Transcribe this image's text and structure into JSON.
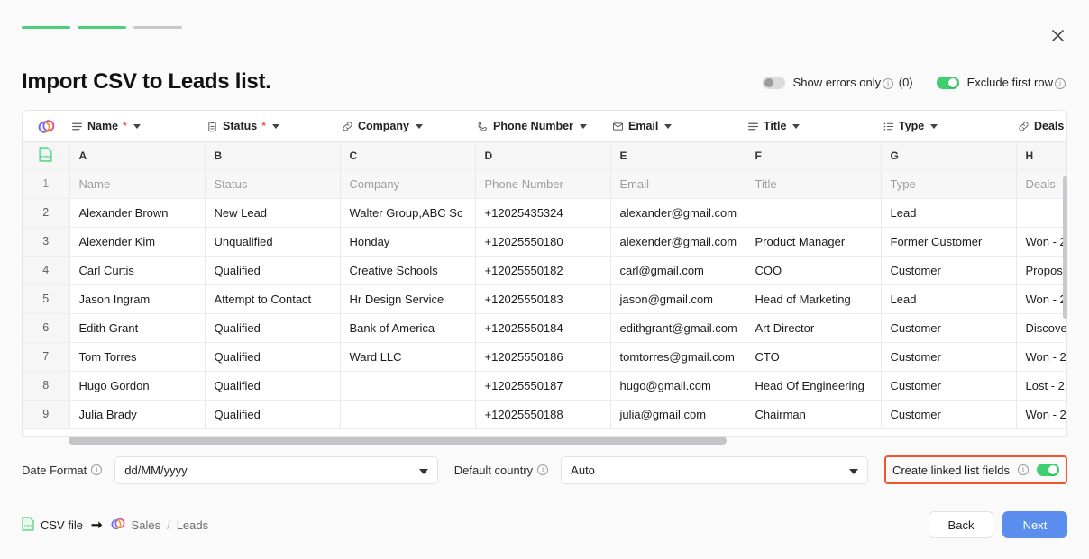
{
  "window": {
    "title": "Import CSV to Leads list.",
    "close_icon": "close-icon",
    "progress_steps": [
      "done",
      "done",
      "todo"
    ]
  },
  "top_controls": {
    "show_errors": {
      "label": "Show errors only",
      "count": "(0)",
      "state": "off",
      "info_icon": "info-icon"
    },
    "exclude_first_row": {
      "label": "Exclude first row",
      "state": "on",
      "info_icon": "info-icon"
    }
  },
  "mapping": {
    "logo_icon": "twenty-logo-icon",
    "fields": [
      {
        "label": "Name",
        "icon": "text-lines-icon",
        "required": "*"
      },
      {
        "label": "Status",
        "icon": "clipboard-icon",
        "required": "*"
      },
      {
        "label": "Company",
        "icon": "link-icon",
        "required": ""
      },
      {
        "label": "Phone Number",
        "icon": "phone-icon",
        "required": ""
      },
      {
        "label": "Email",
        "icon": "envelope-icon",
        "required": ""
      },
      {
        "label": "Title",
        "icon": "text-lines-icon",
        "required": ""
      },
      {
        "label": "Type",
        "icon": "list-icon",
        "required": ""
      },
      {
        "label": "Deals",
        "icon": "link-icon",
        "required": ""
      }
    ]
  },
  "sheet": {
    "corner_icon": "csv-file-icon",
    "column_letters": [
      "A",
      "B",
      "C",
      "D",
      "E",
      "F",
      "G",
      "H"
    ],
    "rows": [
      {
        "num": "1",
        "excluded": true,
        "cells": [
          "Name",
          "Status",
          "Company",
          "Phone Number",
          "Email",
          "Title",
          "Type",
          "Deals"
        ]
      },
      {
        "num": "2",
        "excluded": false,
        "cells": [
          "Alexander Brown",
          "New Lead",
          "Walter Group,ABC Sc",
          "+12025435324",
          "alexander@gmail.com",
          "",
          "Lead",
          ""
        ]
      },
      {
        "num": "3",
        "excluded": false,
        "cells": [
          "Alexender Kim",
          "Unqualified",
          "Honday",
          "+12025550180",
          "alexender@gmail.com",
          "Product Manager",
          "Former Customer",
          "Won - 2"
        ]
      },
      {
        "num": "4",
        "excluded": false,
        "cells": [
          "Carl Curtis",
          "Qualified",
          "Creative Schools",
          "+12025550182",
          "carl@gmail.com",
          "COO",
          "Customer",
          "Proposal"
        ]
      },
      {
        "num": "5",
        "excluded": false,
        "cells": [
          "Jason Ingram",
          "Attempt to Contact",
          "Hr Design Service",
          "+12025550183",
          "jason@gmail.com",
          "Head of Marketing",
          "Lead",
          "Won - 2"
        ]
      },
      {
        "num": "6",
        "excluded": false,
        "cells": [
          "Edith Grant",
          "Qualified",
          "Bank of America",
          "+12025550184",
          "edithgrant@gmail.com",
          "Art Director",
          "Customer",
          "Discovery"
        ]
      },
      {
        "num": "7",
        "excluded": false,
        "cells": [
          "Tom Torres",
          "Qualified",
          "Ward LLC",
          "+12025550186",
          "tomtorres@gmail.com",
          "CTO",
          "Customer",
          "Won - 2"
        ]
      },
      {
        "num": "8",
        "excluded": false,
        "cells": [
          "Hugo Gordon",
          "Qualified",
          "",
          "+12025550187",
          "hugo@gmail.com",
          "Head Of Engineering",
          "Customer",
          "Lost - 2"
        ]
      },
      {
        "num": "9",
        "excluded": false,
        "cells": [
          "Julia Brady",
          "Qualified",
          "",
          "+12025550188",
          "julia@gmail.com",
          "Chairman",
          "Customer",
          "Won - 2"
        ]
      }
    ]
  },
  "options": {
    "date_format": {
      "label": "Date Format",
      "value": "dd/MM/yyyy",
      "info_icon": "info-icon"
    },
    "default_country": {
      "label": "Default country",
      "value": "Auto",
      "info_icon": "info-icon"
    },
    "create_linked_list_fields": {
      "label": "Create linked list fields",
      "state": "on",
      "info_icon": "info-icon",
      "highlight_color": "#f4542e"
    }
  },
  "footer": {
    "source_label": "CSV file",
    "source_icon": "csv-file-icon",
    "arrow_icon": "arrow-right-icon",
    "dest_logo_icon": "twenty-logo-icon",
    "dest_workspace": "Sales",
    "dest_separator": "/",
    "dest_list": "Leads",
    "back_label": "Back",
    "next_label": "Next",
    "next_color": "#5b8def"
  }
}
